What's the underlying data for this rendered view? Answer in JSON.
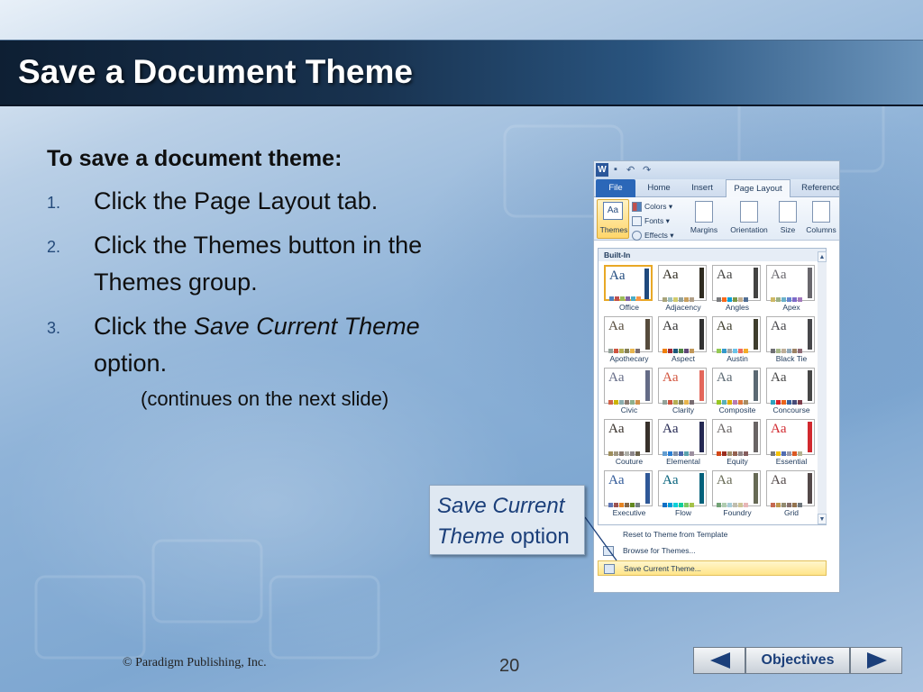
{
  "slide": {
    "title": "Save a Document Theme",
    "heading": "To save a document theme:",
    "steps": [
      {
        "num": "1.",
        "text": "Click the Page Layout tab."
      },
      {
        "num": "2.",
        "text": "Click the Themes button in the Themes group."
      },
      {
        "num": "3.",
        "pre": "Click the ",
        "em": "Save Current Theme",
        "post": " option."
      }
    ],
    "note": "(continues on the next slide)",
    "callout": {
      "em": "Save Current Theme",
      "rest": " option"
    },
    "footer": {
      "copyright": "© Paradigm Publishing, Inc.",
      "page": "20"
    },
    "nav": {
      "objectives": "Objectives"
    }
  },
  "word": {
    "tabs": [
      "File",
      "Home",
      "Insert",
      "Page Layout",
      "Reference"
    ],
    "ribbon": {
      "themes": "Themes",
      "colors": "Colors ▾",
      "fonts": "Fonts ▾",
      "effects": "Effects ▾",
      "margins": "Margins",
      "orientation": "Orientation",
      "size": "Size",
      "columns": "Columns"
    },
    "gallery_header": "Built-In",
    "themes": [
      {
        "name": "Office",
        "colors": [
          "#4f81bd",
          "#c0504d",
          "#9bbb59",
          "#8064a2",
          "#4bacc6",
          "#f79646"
        ],
        "side": "#1f497d",
        "aa": "#1f497d"
      },
      {
        "name": "Adjacency",
        "colors": [
          "#a9a57c",
          "#9cbebd",
          "#d2cb6c",
          "#95a39d",
          "#c89f5d",
          "#b1a089"
        ],
        "side": "#2f2b20",
        "aa": "#2f2b20"
      },
      {
        "name": "Angles",
        "colors": [
          "#797b7e",
          "#f96a1b",
          "#08a1d9",
          "#7c984a",
          "#c2ad8d",
          "#506e94"
        ],
        "side": "#434342",
        "aa": "#434342"
      },
      {
        "name": "Apex",
        "colors": [
          "#ceb966",
          "#9cb084",
          "#6bb1c9",
          "#6585cf",
          "#7e6bc9",
          "#a379bb"
        ],
        "side": "#69676d",
        "aa": "#69676d"
      },
      {
        "name": "Apothecary",
        "colors": [
          "#93a299",
          "#cf543f",
          "#b5ae53",
          "#848058",
          "#e8b54d",
          "#786c71"
        ],
        "side": "#564b3c",
        "aa": "#564b3c"
      },
      {
        "name": "Aspect",
        "colors": [
          "#f07f09",
          "#9f2936",
          "#1b587c",
          "#4e8542",
          "#604878",
          "#c19859"
        ],
        "side": "#323232",
        "aa": "#323232"
      },
      {
        "name": "Austin",
        "colors": [
          "#94c954",
          "#3399cc",
          "#a5a5a5",
          "#6cc3e9",
          "#ef6a5a",
          "#f4ac29"
        ],
        "side": "#3e3d2d",
        "aa": "#3e3d2d"
      },
      {
        "name": "Black Tie",
        "colors": [
          "#6f6f74",
          "#a7b789",
          "#beae98",
          "#92a9b9",
          "#9c8265",
          "#8d6974"
        ],
        "side": "#46464a",
        "aa": "#46464a"
      },
      {
        "name": "Civic",
        "colors": [
          "#d16349",
          "#ccb400",
          "#8cadae",
          "#8c7b70",
          "#8fb08c",
          "#d19049"
        ],
        "side": "#646b86",
        "aa": "#646b86"
      },
      {
        "name": "Clarity",
        "colors": [
          "#93a299",
          "#cf543f",
          "#b5ae53",
          "#848058",
          "#e8b54d",
          "#786c71"
        ],
        "side": "#e3675b",
        "aa": "#d2533c"
      },
      {
        "name": "Composite",
        "colors": [
          "#98c723",
          "#59b0b9",
          "#deae00",
          "#b77bb4",
          "#e0773c",
          "#a98d63"
        ],
        "side": "#5b6973",
        "aa": "#5b6973"
      },
      {
        "name": "Concourse",
        "colors": [
          "#2da2bf",
          "#da1f28",
          "#eb641b",
          "#39639d",
          "#474b78",
          "#7d3c4a"
        ],
        "side": "#464646",
        "aa": "#464646"
      },
      {
        "name": "Couture",
        "colors": [
          "#9e8e5c",
          "#a09781",
          "#85776d",
          "#aeafa9",
          "#8d878b",
          "#6b6149"
        ],
        "side": "#37302a",
        "aa": "#37302a"
      },
      {
        "name": "Elemental",
        "colors": [
          "#629dd1",
          "#297fd5",
          "#7f8fa9",
          "#4a66ac",
          "#5aa2ae",
          "#9d90a0"
        ],
        "side": "#242852",
        "aa": "#242852"
      },
      {
        "name": "Equity",
        "colors": [
          "#d34817",
          "#9b2d1f",
          "#a28e6a",
          "#956251",
          "#918485",
          "#855d5d"
        ],
        "side": "#696464",
        "aa": "#696464"
      },
      {
        "name": "Essential",
        "colors": [
          "#7a7a7a",
          "#f5c201",
          "#526db0",
          "#989aac",
          "#dc5924",
          "#b4b392"
        ],
        "side": "#d1282e",
        "aa": "#d1282e"
      },
      {
        "name": "Executive",
        "colors": [
          "#6076b4",
          "#9c5252",
          "#e68422",
          "#846648",
          "#63891f",
          "#758085"
        ],
        "side": "#2f5897",
        "aa": "#2f5897"
      },
      {
        "name": "Flow",
        "colors": [
          "#0f6fc6",
          "#009dd9",
          "#0bd0d9",
          "#10cf9b",
          "#7cca62",
          "#a5c249"
        ],
        "side": "#04617b",
        "aa": "#04617b"
      },
      {
        "name": "Foundry",
        "colors": [
          "#72a376",
          "#b0ccb0",
          "#a8cdd7",
          "#c0beaf",
          "#cec597",
          "#e8b7b7"
        ],
        "side": "#676a55",
        "aa": "#676a55"
      },
      {
        "name": "Grid",
        "colors": [
          "#c66951",
          "#bf974d",
          "#928b70",
          "#87706b",
          "#94734e",
          "#6f777d"
        ],
        "side": "#534949",
        "aa": "#534949"
      }
    ],
    "menu": [
      {
        "label": "Reset to Theme from Template"
      },
      {
        "label": "Browse for Themes..."
      },
      {
        "label": "Save Current Theme..."
      }
    ]
  }
}
